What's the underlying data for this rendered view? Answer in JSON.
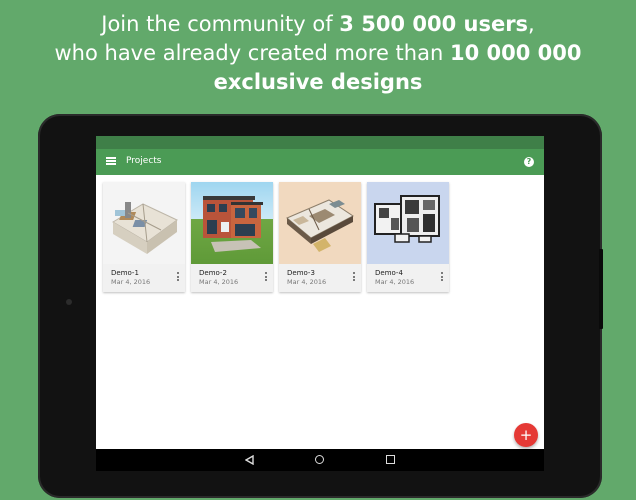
{
  "promo": {
    "line1_prefix": "Join the community of ",
    "line1_bold": "3 500 000 users",
    "line1_suffix": ",",
    "line2_prefix": "who have already created more than ",
    "line2_bold": "10 000 000",
    "line3_bold": "exclusive designs"
  },
  "appbar": {
    "menu_icon": "hamburger-menu-icon",
    "title": "Projects",
    "help_icon": "help-question-icon",
    "help_glyph": "?"
  },
  "projects": [
    {
      "name": "Demo-1",
      "date": "Mar 4, 2016"
    },
    {
      "name": "Demo-2",
      "date": "Mar 4, 2016"
    },
    {
      "name": "Demo-3",
      "date": "Mar 4, 2016"
    },
    {
      "name": "Demo-4",
      "date": "Mar 4, 2016"
    }
  ],
  "fab": {
    "glyph": "+",
    "icon": "add-icon"
  },
  "colors": {
    "background": "#62a96b",
    "appbar": "#4b9b55",
    "statusbar": "#3f7f48",
    "fab": "#e53935"
  }
}
